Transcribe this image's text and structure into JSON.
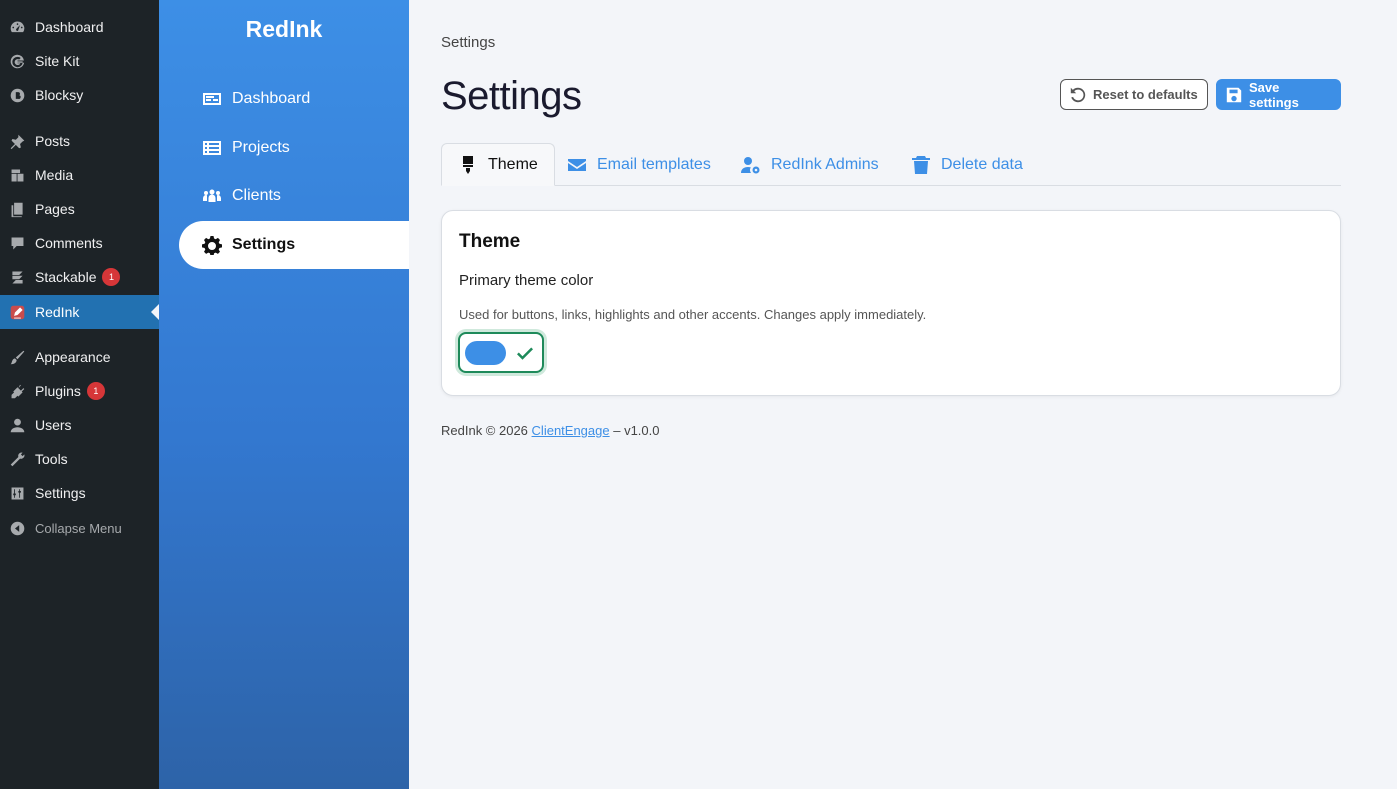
{
  "wp_menu": {
    "items": [
      {
        "label": "Dashboard",
        "icon": "dashboard-icon",
        "badge": ""
      },
      {
        "label": "Site Kit",
        "icon": "google-g-icon",
        "badge": ""
      },
      {
        "label": "Blocksy",
        "icon": "blocksy-icon",
        "badge": ""
      },
      {
        "label": "Posts",
        "icon": "pushpin-icon",
        "badge": ""
      },
      {
        "label": "Media",
        "icon": "media-icon",
        "badge": ""
      },
      {
        "label": "Pages",
        "icon": "pages-icon",
        "badge": ""
      },
      {
        "label": "Comments",
        "icon": "comment-icon",
        "badge": ""
      },
      {
        "label": "Stackable",
        "icon": "stackable-icon",
        "badge": "1"
      },
      {
        "label": "RedInk",
        "icon": "redink-icon",
        "badge": ""
      },
      {
        "label": "Appearance",
        "icon": "paintbrush-icon",
        "badge": ""
      },
      {
        "label": "Plugins",
        "icon": "plug-icon",
        "badge": "1"
      },
      {
        "label": "Users",
        "icon": "user-icon",
        "badge": ""
      },
      {
        "label": "Tools",
        "icon": "wrench-icon",
        "badge": ""
      },
      {
        "label": "Settings",
        "icon": "sliders-icon",
        "badge": ""
      }
    ],
    "collapse_label": "Collapse Menu"
  },
  "sidebar": {
    "brand": "RedInk",
    "items": [
      {
        "label": "Dashboard",
        "icon": "card-icon"
      },
      {
        "label": "Projects",
        "icon": "list-icon"
      },
      {
        "label": "Clients",
        "icon": "users-group-icon"
      },
      {
        "label": "Settings",
        "icon": "gear-icon"
      }
    ]
  },
  "header": {
    "breadcrumb": "Settings",
    "title": "Settings",
    "reset_label": "Reset to defaults",
    "save_label": "Save settings"
  },
  "tabs": [
    {
      "label": "Theme",
      "icon": "paintbrush-icon"
    },
    {
      "label": "Email templates",
      "icon": "envelope-icon"
    },
    {
      "label": "RedInk Admins",
      "icon": "user-gear-icon"
    },
    {
      "label": "Delete data",
      "icon": "trash-icon"
    }
  ],
  "theme_card": {
    "title": "Theme",
    "field_label": "Primary theme color",
    "field_help": "Used for buttons, links, highlights and other accents. Changes apply immediately.",
    "primary_color": "#3d8fe6"
  },
  "footer": {
    "prefix": "RedInk © 2026",
    "link": "ClientEngage",
    "suffix": "– v1.0.0"
  },
  "colors": {
    "accent": "#3d8fe6",
    "wp_active": "#2271b1",
    "badge": "#d63638",
    "success": "#1e8a5a"
  }
}
